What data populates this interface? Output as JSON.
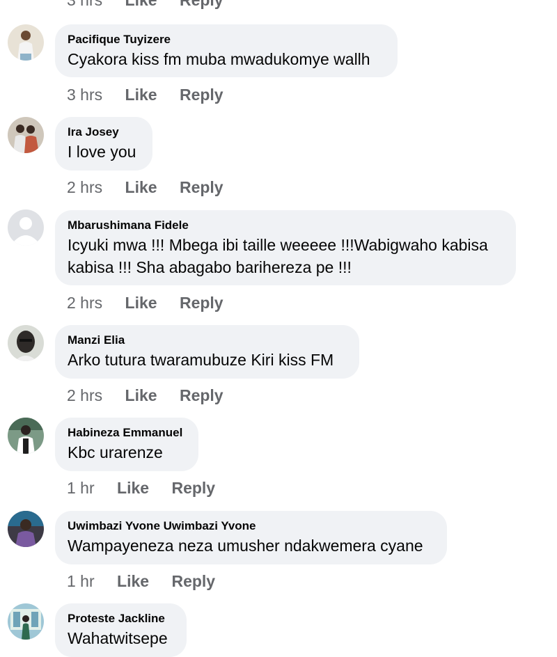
{
  "top_actions": {
    "time": "3 hrs",
    "like": "Like",
    "reply": "Reply"
  },
  "comments": [
    {
      "author": "Pacifique Tuyizere",
      "text": "Cyakora kiss fm muba mwadukomye wallh",
      "time": "3 hrs",
      "like": "Like",
      "reply": "Reply",
      "avatar_icon": "user-photo-avatar-icon",
      "avatar_color": "#b9a58a"
    },
    {
      "author": "Ira Josey",
      "text": "I love you",
      "time": "2 hrs",
      "like": "Like",
      "reply": "Reply",
      "avatar_icon": "user-photo-avatar-icon",
      "avatar_color": "#c2593f"
    },
    {
      "author": "Mbarushimana Fidele",
      "text": "Icyuki mwa !!! Mbega ibi taille weeeee !!!Wabigwaho kabisa kabisa !!! Sha abagabo barihereza pe !!!",
      "time": "2 hrs",
      "like": "Like",
      "reply": "Reply",
      "avatar_icon": "default-avatar-icon",
      "avatar_color": "#bcc0c4"
    },
    {
      "author": "Manzi Elia",
      "text": "Arko tutura twaramubuze Kiri kiss FM",
      "time": "2 hrs",
      "like": "Like",
      "reply": "Reply",
      "avatar_icon": "user-photo-avatar-icon",
      "avatar_color": "#3b3b3b"
    },
    {
      "author": "Habineza Emmanuel",
      "text": "Kbc urarenze",
      "time": "1 hr",
      "like": "Like",
      "reply": "Reply",
      "avatar_icon": "user-photo-avatar-icon",
      "avatar_color": "#4a6b57"
    },
    {
      "author": "Uwimbazi Yvone Uwimbazi Yvone",
      "text": "Wampayeneza neza umusher ndakwemera cyane",
      "time": "1 hr",
      "like": "Like",
      "reply": "Reply",
      "avatar_icon": "user-photo-avatar-icon",
      "avatar_color": "#5a4a6e"
    },
    {
      "author": "Proteste Jackline",
      "text": "Wahatwitsepe",
      "avatar_icon": "user-photo-avatar-icon",
      "avatar_color": "#6fa3b8"
    }
  ]
}
